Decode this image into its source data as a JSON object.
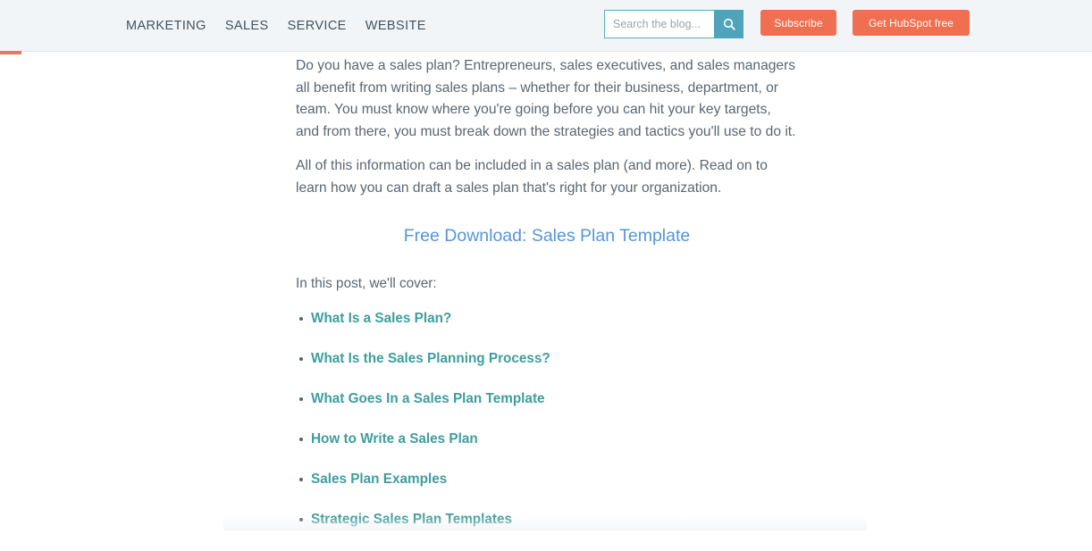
{
  "header": {
    "background_color": "#f2f5f7",
    "nav_items": [
      {
        "label": "MARKETING"
      },
      {
        "label": "SALES"
      },
      {
        "label": "SERVICE"
      },
      {
        "label": "WEBSITE"
      }
    ],
    "search": {
      "placeholder": "Search the blog...",
      "value": "",
      "icon": "search-icon",
      "button_color": "#4fa3bb",
      "border_color": "#5bacbd"
    },
    "subscribe_button": {
      "label": "Subscribe",
      "color": "#ef6f50"
    },
    "trial_button": {
      "label": "Get HubSpot free",
      "color": "#ef6f50"
    },
    "reading_progress": {
      "percent": 2,
      "color": "#e4795d"
    }
  },
  "article": {
    "paragraphs": [
      "Do you have a sales plan? Entrepreneurs, sales executives, and sales managers all benefit from writing sales plans – whether for their business, department, or team. You must know where you're going before you can hit your key targets, and from there, you must break down the strategies and tactics you'll use to do it.",
      "All of this information can be included in a sales plan (and more). Read on to learn how you can draft a sales plan that's right for your organization."
    ],
    "download_heading": {
      "label": "Free Download: Sales Plan Template",
      "color": "#5596d8"
    },
    "cover_lead": "In this post, we'll cover:",
    "toc": [
      {
        "label": "What Is a Sales Plan?"
      },
      {
        "label": "What Is the Sales Planning Process?"
      },
      {
        "label": "What Goes In a Sales Plan Template"
      },
      {
        "label": "How to Write a Sales Plan"
      },
      {
        "label": "Sales Plan Examples"
      },
      {
        "label": "Strategic Sales Plan Templates"
      }
    ],
    "link_color": "#3f9d9e",
    "text_color": "#5b6670"
  }
}
